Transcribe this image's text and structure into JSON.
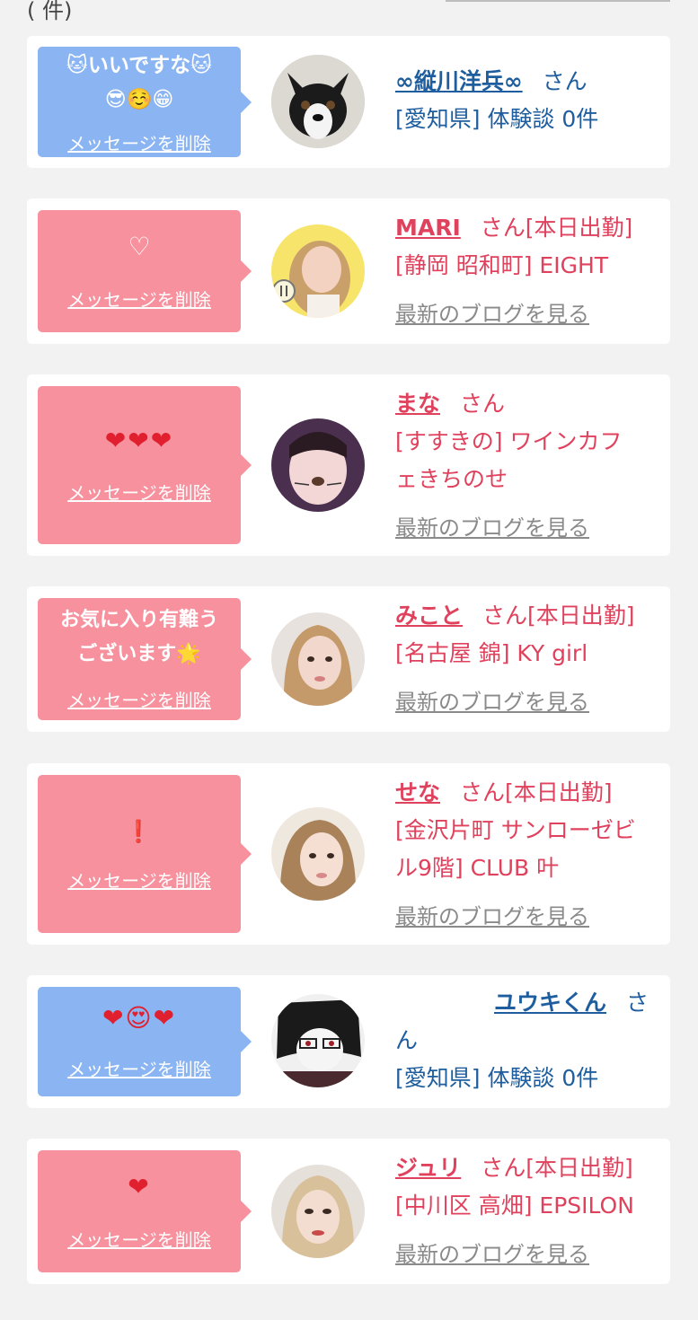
{
  "top_fragment": "(       件)",
  "delete_label": "メッセージを削除",
  "blog_label": "最新のブログを見る",
  "san": "さん",
  "messages": [
    {
      "color": "blue",
      "message_line1": "🐱いいですな🐱",
      "message_line2": "😎☺️😁",
      "name": "∞縦川洋兵∞",
      "suffix": "",
      "line1": "[愛知県] 体験談 0件",
      "line2": "",
      "has_blog": false
    },
    {
      "color": "pink",
      "message_line1": "♡",
      "message_line2": "",
      "name": "MARI",
      "suffix": "[本日出勤]",
      "line1": "[静岡 昭和町] EIGHT",
      "line2": "",
      "has_blog": true
    },
    {
      "color": "pink",
      "message_line1": "❤❤❤",
      "message_line2": "",
      "name": "まな",
      "suffix": "",
      "line1": "[すすきの] ワインカフ",
      "line2": "ェきちのせ",
      "has_blog": true
    },
    {
      "color": "pink",
      "message_line1": "お気に入り有難う",
      "message_line2": "ございます🌟",
      "name": "みこと",
      "suffix": "[本日出勤]",
      "line1": "[名古屋 錦] KY girl",
      "line2": "",
      "has_blog": true
    },
    {
      "color": "pink",
      "message_line1": "❗",
      "message_line2": "",
      "name": "せな",
      "suffix": "[本日出勤]",
      "line1": "[金沢片町 サンローゼビ",
      "line2": "ル9階] CLUB 叶",
      "has_blog": true
    },
    {
      "color": "blue",
      "message_line1": "❤😍❤",
      "message_line2": "",
      "name": "ユウキくん",
      "suffix": "",
      "line1": "[愛知県] 体験談 0件",
      "line2": "",
      "has_blog": false
    },
    {
      "color": "pink",
      "message_line1": "❤",
      "message_line2": "",
      "name": "ジュリ",
      "suffix": "[本日出勤]",
      "line1": "[中川区 高畑] EPSILON",
      "line2": "",
      "has_blog": true
    }
  ]
}
